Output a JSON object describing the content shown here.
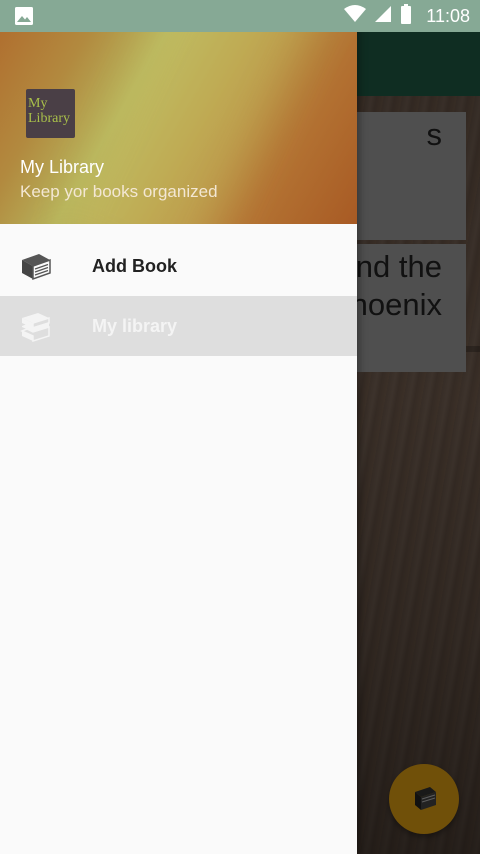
{
  "status_bar": {
    "time": "11:08",
    "icons": [
      "image-notification-icon",
      "wifi-icon",
      "cell-signal-icon",
      "battery-icon"
    ]
  },
  "drawer": {
    "header": {
      "logo_line1": "My",
      "logo_line2": "Library",
      "title": "My Library",
      "subtitle": "Keep yor books organized"
    },
    "items": [
      {
        "label": "Add Book",
        "icon": "book-icon",
        "selected": false
      },
      {
        "label": "My library",
        "icon": "books-stack-icon",
        "selected": true
      }
    ]
  },
  "background": {
    "card1_text": "s",
    "card2_line1": "nd the",
    "card2_line2": "hoenix",
    "fab_icon": "book-icon"
  },
  "colors": {
    "status_bar": "#86a995",
    "toolbar": "#1f5a45",
    "fab": "#e1a012",
    "drawer_bg": "#fafafa",
    "selected_item_bg": "#dedede"
  }
}
